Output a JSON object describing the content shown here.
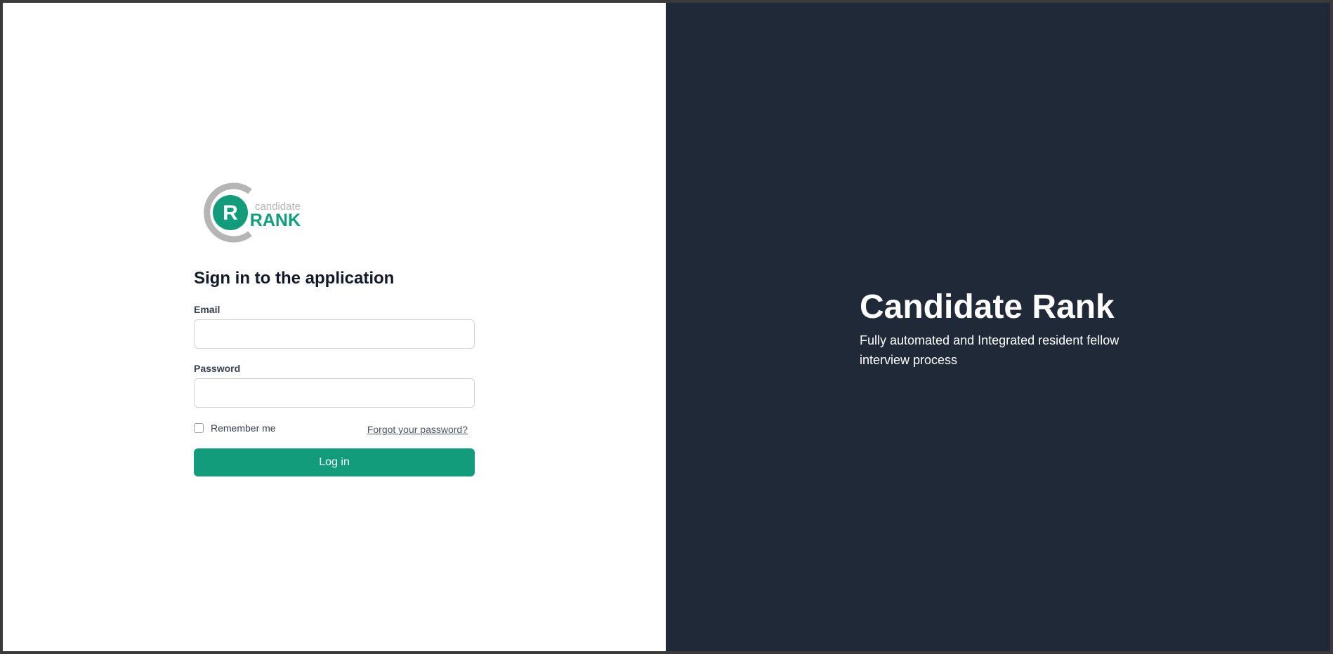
{
  "logo": {
    "top_text": "candidate",
    "bottom_text": "RANK",
    "letter": "R",
    "brand_color": "#139c7c",
    "ring_color": "#b5b5b5"
  },
  "login": {
    "title": "Sign in to the application",
    "email_label": "Email",
    "email_value": "",
    "password_label": "Password",
    "password_value": "",
    "remember_label": "Remember me",
    "forgot_link": "Forgot your password?",
    "submit_label": "Log in"
  },
  "hero": {
    "title": "Candidate Rank",
    "subtitle": "Fully automated and Integrated resident fellow interview process"
  },
  "colors": {
    "dark_panel": "#1f2937",
    "button": "#139c7c"
  }
}
